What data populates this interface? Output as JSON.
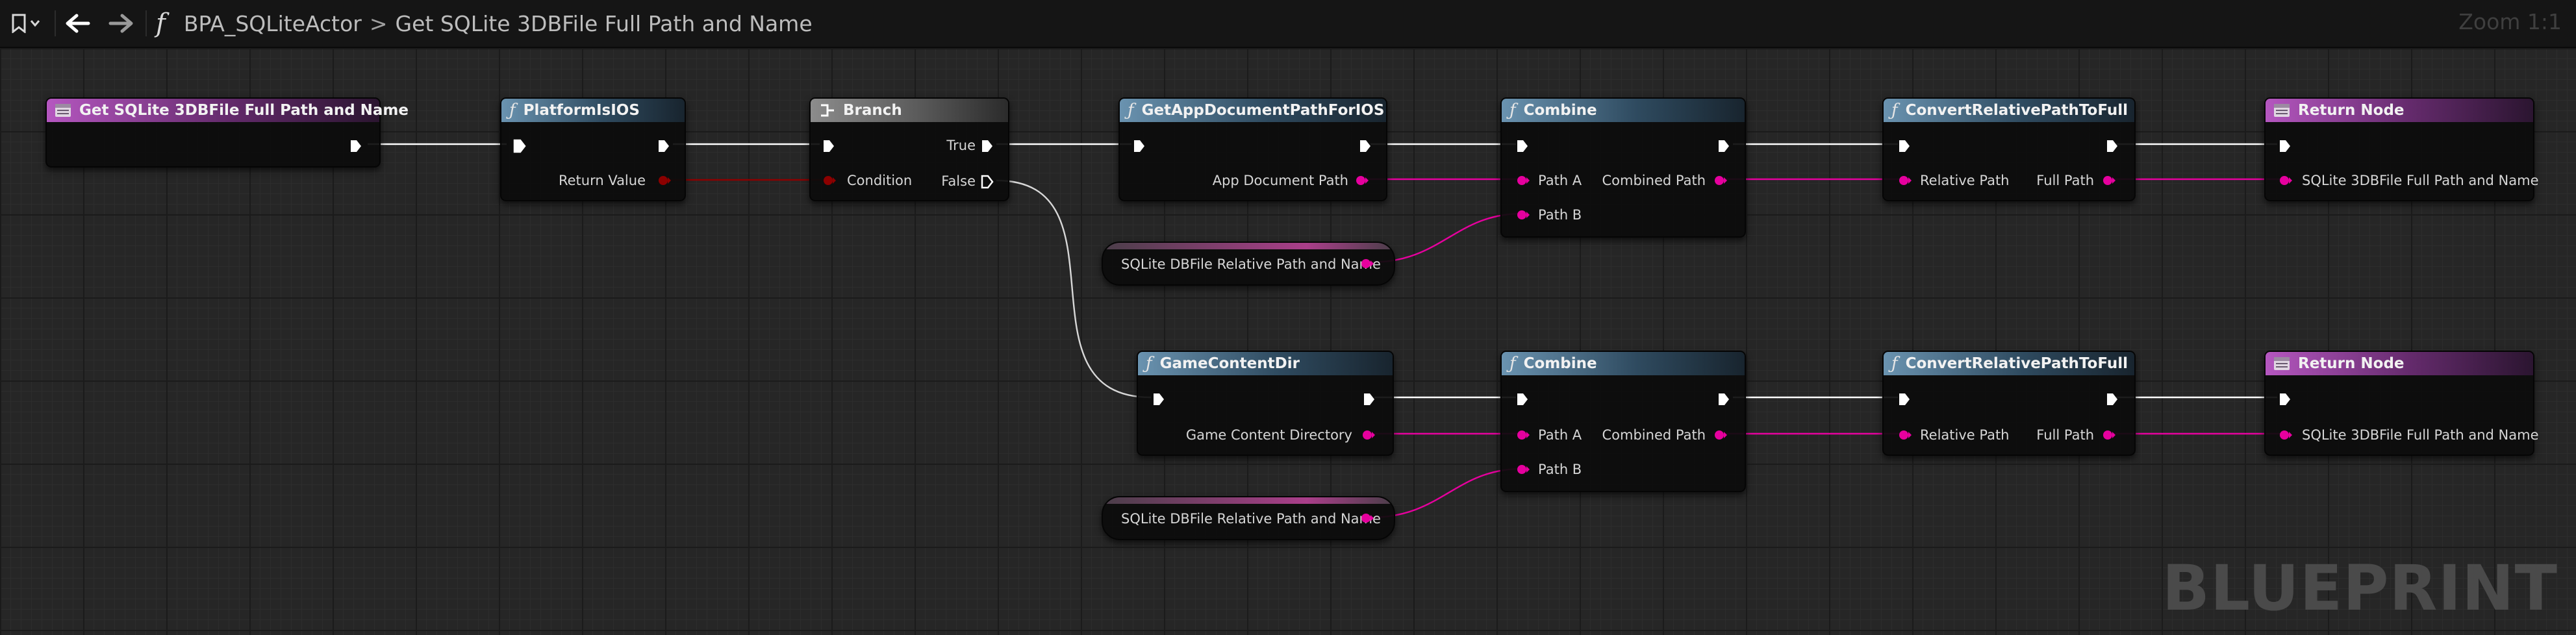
{
  "toolbar": {
    "bookmark_icon": "bookmark-icon",
    "back_icon": "arrow-left-icon",
    "forward_icon": "arrow-right-icon",
    "function_icon": "function-icon"
  },
  "breadcrumb": {
    "function_glyph": "f",
    "blueprint": "BPA_SQLiteActor",
    "separator": ">",
    "graph": "Get SQLite 3DBFile Full Path and Name"
  },
  "zoom": "Zoom 1:1",
  "watermark": "BLUEPRINT",
  "colors": {
    "exec_wire": "#ffffff",
    "string_wire": "#e6009e",
    "bool_wire": "#8c0000",
    "function_header": "#4e7a99",
    "event_header": "#a43ea8"
  },
  "nodes": {
    "entry": {
      "title": "Get SQLite 3DBFile Full Path and Name"
    },
    "platform_is_ios": {
      "title": "PlatformIsIOS",
      "return_value": "Return Value"
    },
    "branch": {
      "title": "Branch",
      "condition": "Condition",
      "true": "True",
      "false": "False"
    },
    "get_app_doc_path": {
      "title": "GetAppDocumentPathForIOS",
      "out_pin": "App Document Path"
    },
    "combine_top": {
      "title": "Combine",
      "path_a": "Path A",
      "path_b": "Path B",
      "out_pin": "Combined Path"
    },
    "convert_top": {
      "title": "ConvertRelativePathToFull",
      "in_pin": "Relative Path",
      "out_pin": "Full Path"
    },
    "return_top": {
      "title": "Return Node",
      "in_pin": "SQLite 3DBFile Full Path and Name"
    },
    "var_top": {
      "label": "SQLite DBFile Relative Path and Name"
    },
    "game_content_dir": {
      "title": "GameContentDir",
      "out_pin": "Game Content Directory"
    },
    "combine_bottom": {
      "title": "Combine",
      "path_a": "Path A",
      "path_b": "Path B",
      "out_pin": "Combined Path"
    },
    "convert_bottom": {
      "title": "ConvertRelativePathToFull",
      "in_pin": "Relative Path",
      "out_pin": "Full Path"
    },
    "return_bottom": {
      "title": "Return Node",
      "in_pin": "SQLite 3DBFile Full Path and Name"
    },
    "var_bottom": {
      "label": "SQLite DBFile Relative Path and Name"
    }
  }
}
